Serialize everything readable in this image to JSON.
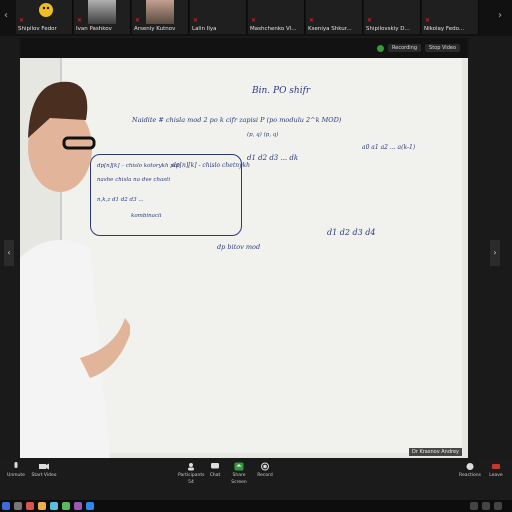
{
  "participants": [
    {
      "name": "Nikolay Fedo...",
      "muted": true
    },
    {
      "name": "Shipilovskiy D...",
      "muted": true
    },
    {
      "name": "Kseniya Shkur...",
      "muted": true
    },
    {
      "name": "Mashchenko Vl...",
      "muted": true
    },
    {
      "name": "Lalin Ilya",
      "muted": true
    },
    {
      "name": "Arseniy Kutnov",
      "muted": true
    },
    {
      "name": "Ivan Pashkov",
      "muted": true
    },
    {
      "name": "Shipilov Fedor",
      "muted": true
    }
  ],
  "recording": {
    "label": "Recording",
    "stop_label": "Stop Video"
  },
  "presenter_caption": "Dr Krasnov Andrey",
  "whiteboard": {
    "title": "Bin. PO shifr",
    "line1": "Naidite # chisla mod 2 po k cifr zapisi P (po modulu 2^k MOD)",
    "line2": "(p, q)  (p, q)",
    "eq_right": "a0 a1 a2 ... a(k-1)",
    "seq1": "d1 d2 d3 ... dk",
    "mid": "dp[n][k] - chislo chetnykh",
    "boxed1": "dp[n][k] – chislo kotorykh pol",
    "boxed2": "nashe chisla na dve chasti",
    "boxed3": "n,k,z d1 d2 d3 ...",
    "boxed4": "kombinacii",
    "under": "dp bitov mod",
    "seq2": "d1 d2 d3 d4"
  },
  "toolbar": {
    "left": [
      {
        "label": "Unmute"
      },
      {
        "label": "Start Video"
      }
    ],
    "center": [
      {
        "label": "Participants",
        "count": "54"
      },
      {
        "label": "Chat"
      },
      {
        "label": "Share Screen"
      },
      {
        "label": "Record"
      }
    ],
    "right": [
      {
        "label": "Reactions"
      },
      {
        "label": "Leave"
      }
    ]
  },
  "colors": {
    "accent": "#3a9a3a",
    "muted": "#e03030",
    "ink": "#2c3a7a"
  }
}
